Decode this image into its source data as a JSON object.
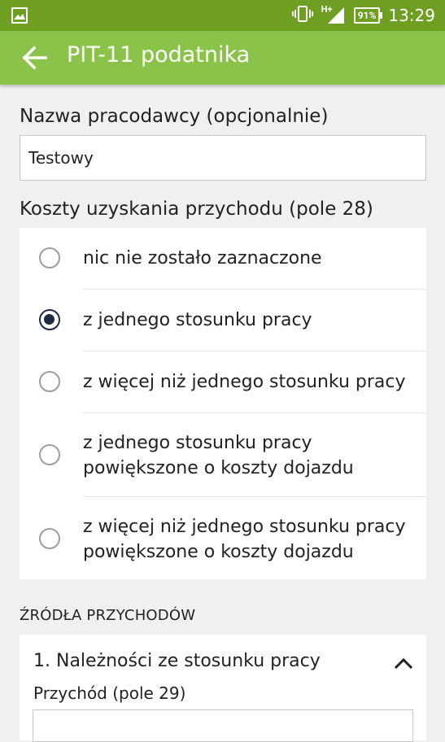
{
  "status_bar": {
    "battery": "91%",
    "time": "13:29",
    "network": "H+"
  },
  "app_bar": {
    "title": "PIT-11 podatnika"
  },
  "employer": {
    "label": "Nazwa pracodawcy (opcjonalnie)",
    "value": "Testowy"
  },
  "costs": {
    "label": "Koszty uzyskania przychodu (pole 28)",
    "selected": 1,
    "options": [
      {
        "line1": "nic nie zostało zaznaczone",
        "line2": ""
      },
      {
        "line1": "z jednego stosunku pracy",
        "line2": ""
      },
      {
        "line1": "z więcej niż jednego stosunku pracy",
        "line2": ""
      },
      {
        "line1": "z jednego stosunku pracy",
        "line2": "powiększone o koszty dojazdu"
      },
      {
        "line1": "z więcej niż jednego stosunku pracy",
        "line2": "powiększone o koszty dojazdu"
      }
    ]
  },
  "sources": {
    "header": "ŹRÓDŁA PRZYCHODÓW",
    "item_title": "1. Należności ze stosunku pracy",
    "income_label": "Przychód (pole 29)",
    "income_value": ""
  }
}
